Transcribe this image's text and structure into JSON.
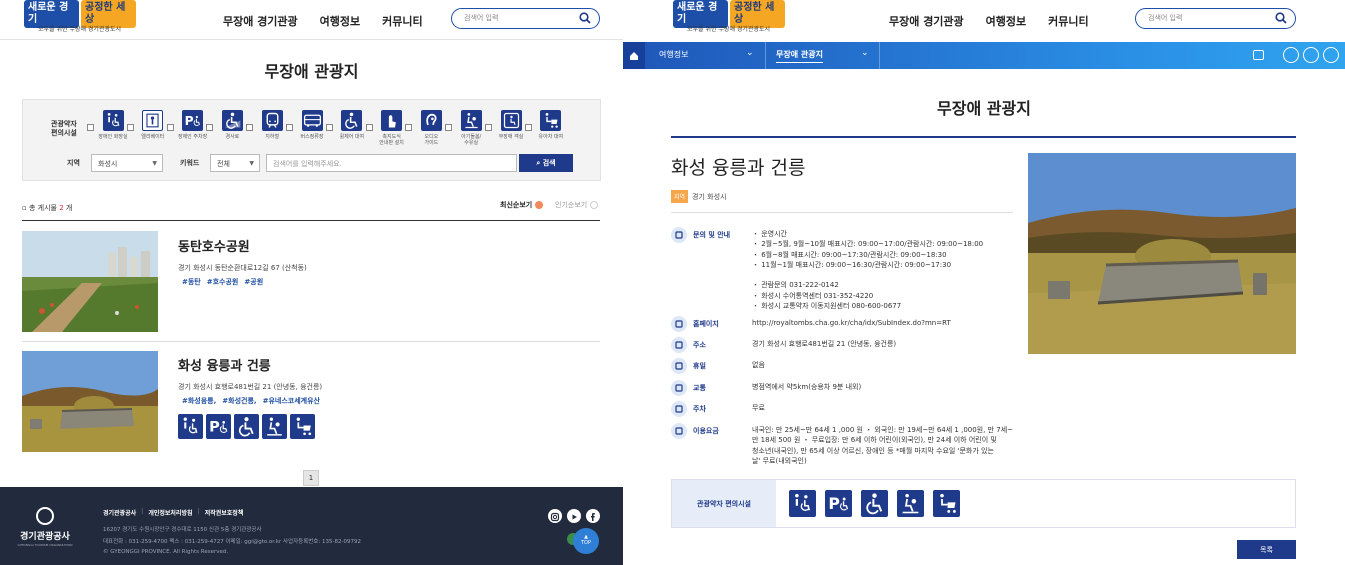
{
  "header": {
    "logo_part1": "새로운 경기",
    "logo_part2": "공정한 세상",
    "logo_sub": "모두를 위한 무장애 경기관광도시",
    "nav": [
      "무장애 경기관광",
      "여행정보",
      "커뮤니티"
    ],
    "search_placeholder": "검색어 입력"
  },
  "list_page": {
    "title": "무장애 관광지",
    "filter": {
      "facility_label": "관광약자\n편의시설",
      "facilities": [
        {
          "icon": "accessible-toilet-icon",
          "label": "장애인 화장실"
        },
        {
          "icon": "elevator-icon",
          "label": "엘리베이터"
        },
        {
          "icon": "accessible-parking-icon",
          "label": "장애인 주차장"
        },
        {
          "icon": "ramp-icon",
          "label": "경사로"
        },
        {
          "icon": "subway-icon",
          "label": "지하철"
        },
        {
          "icon": "bus-stop-icon",
          "label": "버스정류장"
        },
        {
          "icon": "wheelchair-rental-icon",
          "label": "휠체어 대여"
        },
        {
          "icon": "tactile-guide-icon",
          "label": "촉지도식\n안내판 설치"
        },
        {
          "icon": "audio-guide-icon",
          "label": "오디오\n가이드"
        },
        {
          "icon": "nursing-room-icon",
          "label": "아기돌봄/\n수유실"
        },
        {
          "icon": "barrier-free-room-icon",
          "label": "무장애 객실"
        },
        {
          "icon": "stroller-rental-icon",
          "label": "유아차 대여"
        }
      ],
      "region_label": "지역",
      "region_value": "화성시",
      "keyword_label": "키워드",
      "keyword_select": "전체",
      "keyword_placeholder": "검색어를 입력해주세요.",
      "search_button": "검색"
    },
    "count_prefix": "총 게시물",
    "count_value": "2",
    "count_suffix": "개",
    "sort_latest": "최신순보기",
    "sort_popular": "인기순보기",
    "items": [
      {
        "name": "동탄호수공원",
        "address": "경기 화성시 동탄순환대로12길 67 (산척동)",
        "tags": [
          "#동탄",
          "#호수공원",
          "#공원"
        ]
      },
      {
        "name": "화성 융릉과 건릉",
        "address": "경기 화성시 효행로481번길 21 (안녕동, 융건릉)",
        "tags": [
          "#화성융릉,",
          "#화성건릉,",
          "#유네스코세계유산"
        ],
        "facility_icons": [
          "accessible-toilet-icon",
          "accessible-parking-icon",
          "wheelchair-rental-icon",
          "nursing-room-icon",
          "stroller-rental-icon"
        ]
      }
    ],
    "page": "1"
  },
  "footer": {
    "org": "경기관광공사",
    "org_en": "GYEONGGI TOURISM ORGANIZATION",
    "links": [
      "경기관광공사",
      "개인정보처리방침",
      "저작권보호정책"
    ],
    "address": "16207 경기도 수원시장안구 경수대로 1150 신관 5층 경기관광공사",
    "contact": "대표전화 : 031-259-4700     팩스 : 031-259-4727     이메일: ggi@gto.or.kr     사업자등록번호: 135-82-09792",
    "copyright": "© GYEONGGI PROVINCE. All Rights Reserved.",
    "top_label": "TOP"
  },
  "detail_page": {
    "nav_select1": "여행정보",
    "nav_select2": "무장애 관광지",
    "title": "무장애 관광지",
    "place_name": "화성 융릉과 건릉",
    "region_tag": "지역",
    "region_value": "경기 화성시",
    "rows": [
      {
        "icon": "phone-icon",
        "label": "문의 및 안내",
        "value": "・ 운영시간\n・ 2월~5월, 9월~10월 매표시간: 09:00~17:00/관람시간: 09:00~18:00\n・ 6월~8월 매표시간: 09:00~17:30/관람시간: 09:00~18:30\n・ 11월~1월 매표시간: 09:00~16:30/관람시간: 09:00~17:30\n\n・ 관람문의 031-222-0142\n・ 화성시 수어통역센터 031-352-4220\n・ 화성시 교통약자 이동지원센터 080-600-0677"
      },
      {
        "icon": "monitor-icon",
        "label": "홈페이지",
        "value": "http://royaltombs.cha.go.kr/cha/idx/SubIndex.do?mn=RT"
      },
      {
        "icon": "location-pin-icon",
        "label": "주소",
        "value": "경기 화성시 효행로481번길 21 (안녕동, 융건릉)"
      },
      {
        "icon": "calendar-icon",
        "label": "휴일",
        "value": "없음"
      },
      {
        "icon": "transport-icon",
        "label": "교통",
        "value": "병점역에서 약5km(승용차 9분 내외)"
      },
      {
        "icon": "parking-icon",
        "label": "주차",
        "value": "무료"
      },
      {
        "icon": "ticket-icon",
        "label": "이용요금",
        "value": "내국인: 만 25세~만 64세 1 ,000 원 ・ 외국인: 만 19세~만 64세 1 ,000원, 만 7세~\n만 18세 500 원 ・ 무료입장: 만 6세 이하 어린이(외국인), 만 24세 이하 어린이 및\n청소년(내국인), 만 65세 이상 어르신, 장애인 등 *매월 마지막 수요일 '문화가 있는\n날' 무료(내외국인)"
      }
    ],
    "facilities_label": "관광약자 편의시설",
    "facility_icons": [
      "accessible-toilet-icon",
      "accessible-parking-icon",
      "wheelchair-rental-icon",
      "nursing-room-icon",
      "stroller-rental-icon"
    ],
    "list_button": "목록"
  },
  "colors": {
    "brand_navy": "#1f3a8a",
    "accent_orange": "#f5a64a",
    "footer_bg": "#222b3d"
  }
}
